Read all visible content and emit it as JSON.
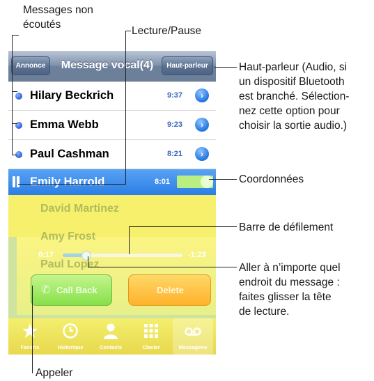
{
  "callouts": {
    "unheard_messages": "Messages non\nécoutés",
    "play_pause": "Lecture/Pause",
    "speaker": "Haut-parleur (Audio, si\nun dispositif Bluetooth\nest branché. Sélection-\nnez cette option pour\nchoisir la sortie audio.)",
    "contact_info": "Coordonnées",
    "scrub_bar": "Barre de défilement",
    "scrub_anywhere": "Aller à n’importe quel\nendroit du message :\nfaites glisser la tête\nde lecture.",
    "call": "Appeler"
  },
  "navbar": {
    "left_button": "Annonce",
    "title": "Message vocal(4)",
    "right_button": "Haut-parleur"
  },
  "messages": [
    {
      "name": "Hilary Beckrich",
      "time": "9:37",
      "unheard": true
    },
    {
      "name": "Emma Webb",
      "time": "9:23",
      "unheard": true
    },
    {
      "name": "Paul Cashman",
      "time": "8:21",
      "unheard": true
    }
  ],
  "selected_message": {
    "name": "Emily Harrold",
    "time": "8:01"
  },
  "hidden_rows": [
    "David Martinez",
    "Amy Frost",
    "Paul Lopez"
  ],
  "player": {
    "elapsed": "0:17",
    "remaining": "-1:23",
    "progress": 0.2,
    "call_button": "Call Back",
    "delete_button": "Delete"
  },
  "tabs": [
    {
      "label": "Favoris",
      "icon": "star-icon"
    },
    {
      "label": "Historique",
      "icon": "clock-icon"
    },
    {
      "label": "Contacts",
      "icon": "person-icon"
    },
    {
      "label": "Clavier",
      "icon": "keypad-icon"
    },
    {
      "label": "Messagerie",
      "icon": "voicemail-icon",
      "active": true
    }
  ]
}
